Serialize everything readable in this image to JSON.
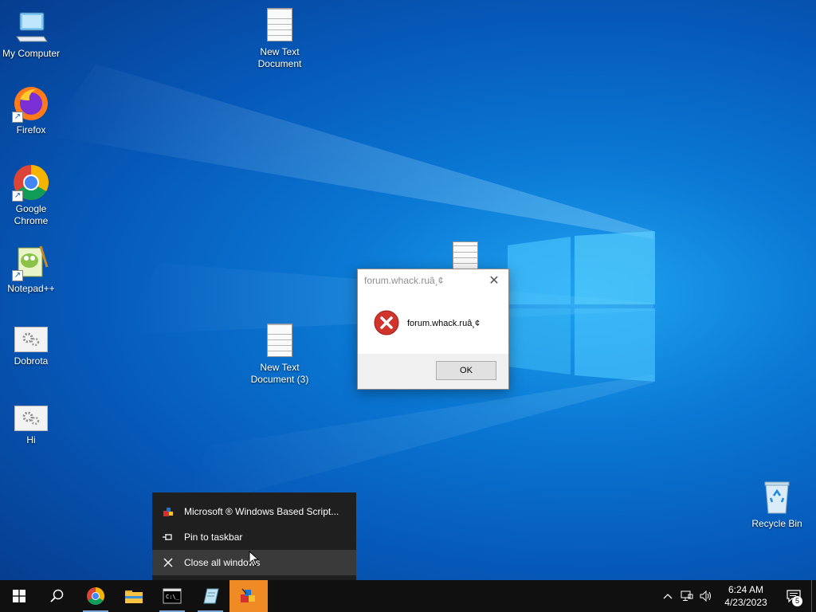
{
  "desktop": {
    "icons": [
      {
        "label": "My Computer",
        "icon": "computer-icon"
      },
      {
        "label": "Firefox",
        "icon": "firefox-icon"
      },
      {
        "label": "Google Chrome",
        "icon": "chrome-icon"
      },
      {
        "label": "Notepad++",
        "icon": "notepadpp-icon"
      },
      {
        "label": "Dobrota",
        "icon": "settings-file-icon"
      },
      {
        "label": "Hi",
        "icon": "settings-file-icon"
      },
      {
        "label": "New Text Document",
        "icon": "text-file-icon"
      },
      {
        "label": "New Text Document (3)",
        "icon": "text-file-icon"
      },
      {
        "label": "Recycle Bin",
        "icon": "recycle-bin-icon"
      }
    ]
  },
  "dialog": {
    "title": "forum.whack.ruâ¸¢",
    "message": "forum.whack.ruâ¸¢",
    "ok_label": "OK",
    "close_glyph": "✕",
    "icon": "error-icon"
  },
  "jumplist": {
    "items": [
      {
        "label": "Microsoft ® Windows Based Script...",
        "icon": "wscript-icon"
      },
      {
        "label": "Pin to taskbar",
        "icon": "pin-icon"
      },
      {
        "label": "Close all windows",
        "icon": "close-icon"
      }
    ]
  },
  "taskbar": {
    "items": [
      "start-icon",
      "search-icon",
      "chrome-icon",
      "file-explorer-icon",
      "cmd-icon",
      "notepad-app-icon",
      "wscript-icon"
    ],
    "clock_time": "6:24 AM",
    "clock_date": "4/23/2023",
    "notification_count": "5",
    "tray": [
      "chevron-up-icon",
      "network-icon",
      "volume-icon"
    ]
  },
  "colors": {
    "desktop_blue": "#0a78d4",
    "taskbar": "#101010",
    "jumplist": "#1f1f1f",
    "highlight": "#f08a24",
    "error_red": "#d0342c"
  }
}
